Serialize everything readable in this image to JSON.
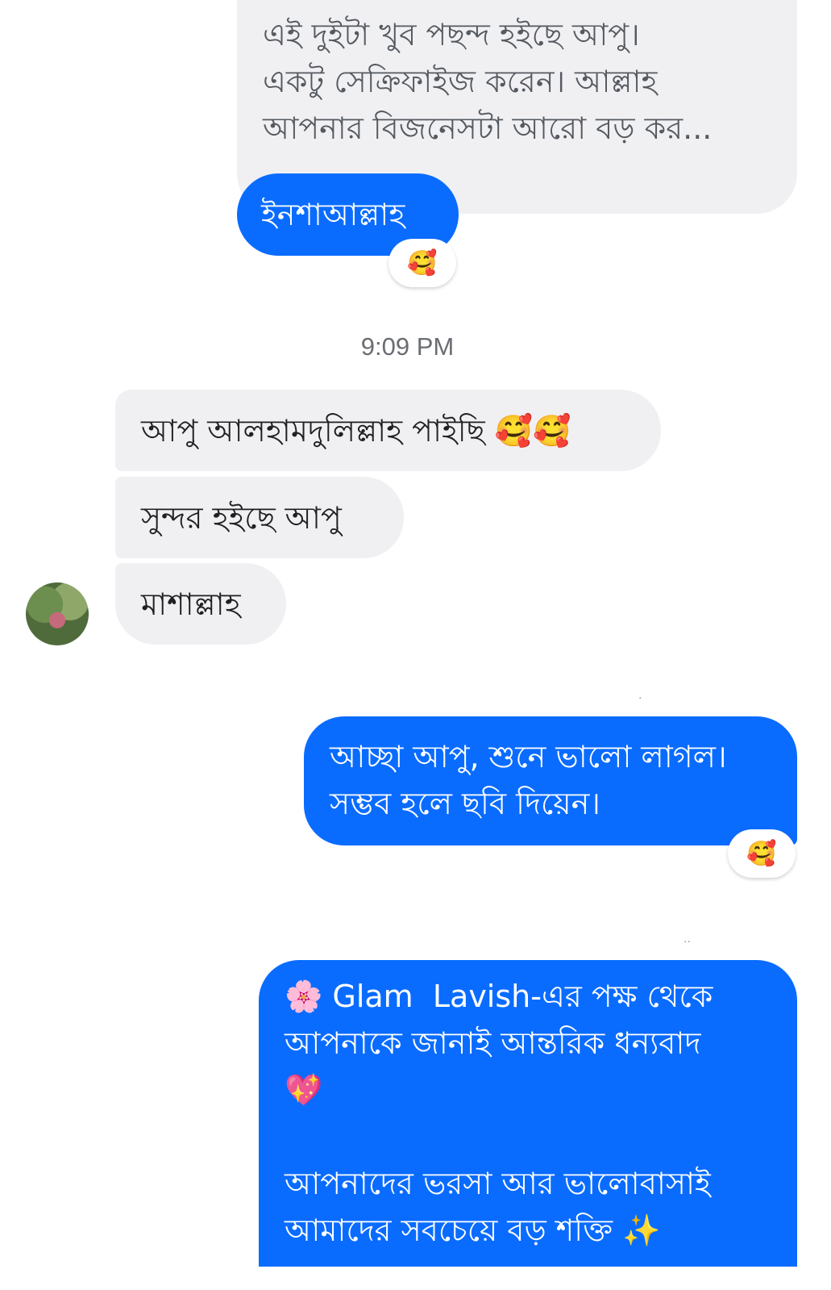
{
  "quoted_message": {
    "text": "এই দুইটা খুব পছন্দ হইছে আপু।\nএকটু সেক্রিফাইজ করেন। আল্লাহ\nআপনার বিজনেসটা আরো বড় কর..."
  },
  "reply_to_quote": {
    "text": "ইনশাআল্লাহ",
    "reaction": "🥰"
  },
  "timestamp": "9:09 PM",
  "incoming_messages": [
    {
      "text": "আপু আলহামদুলিল্লাহ পাইছি 🥰🥰"
    },
    {
      "text": "সুন্দর হইছে আপু"
    },
    {
      "text": "মাশাল্লাহ"
    }
  ],
  "outgoing_message_1": {
    "text": "আচ্ছা আপু, শুনে ভালো লাগল।\nসম্ভব হলে ছবি দিয়েন।",
    "reaction": "🥰"
  },
  "outgoing_message_2": {
    "text": "🌸 Glam  Lavish-এর পক্ষ থেকে\nআপনাকে জানাই আন্তরিক ধন্যবাদ\n💖\n\nআপনাদের ভরসা আর ভালোবাসাই\nআমাদের সবচেয়ে বড় শক্তি ✨"
  },
  "colors": {
    "outgoing_bubble": "#0a6cff",
    "incoming_bubble": "#f0f0f3",
    "timestamp_text": "#6a6d72"
  }
}
